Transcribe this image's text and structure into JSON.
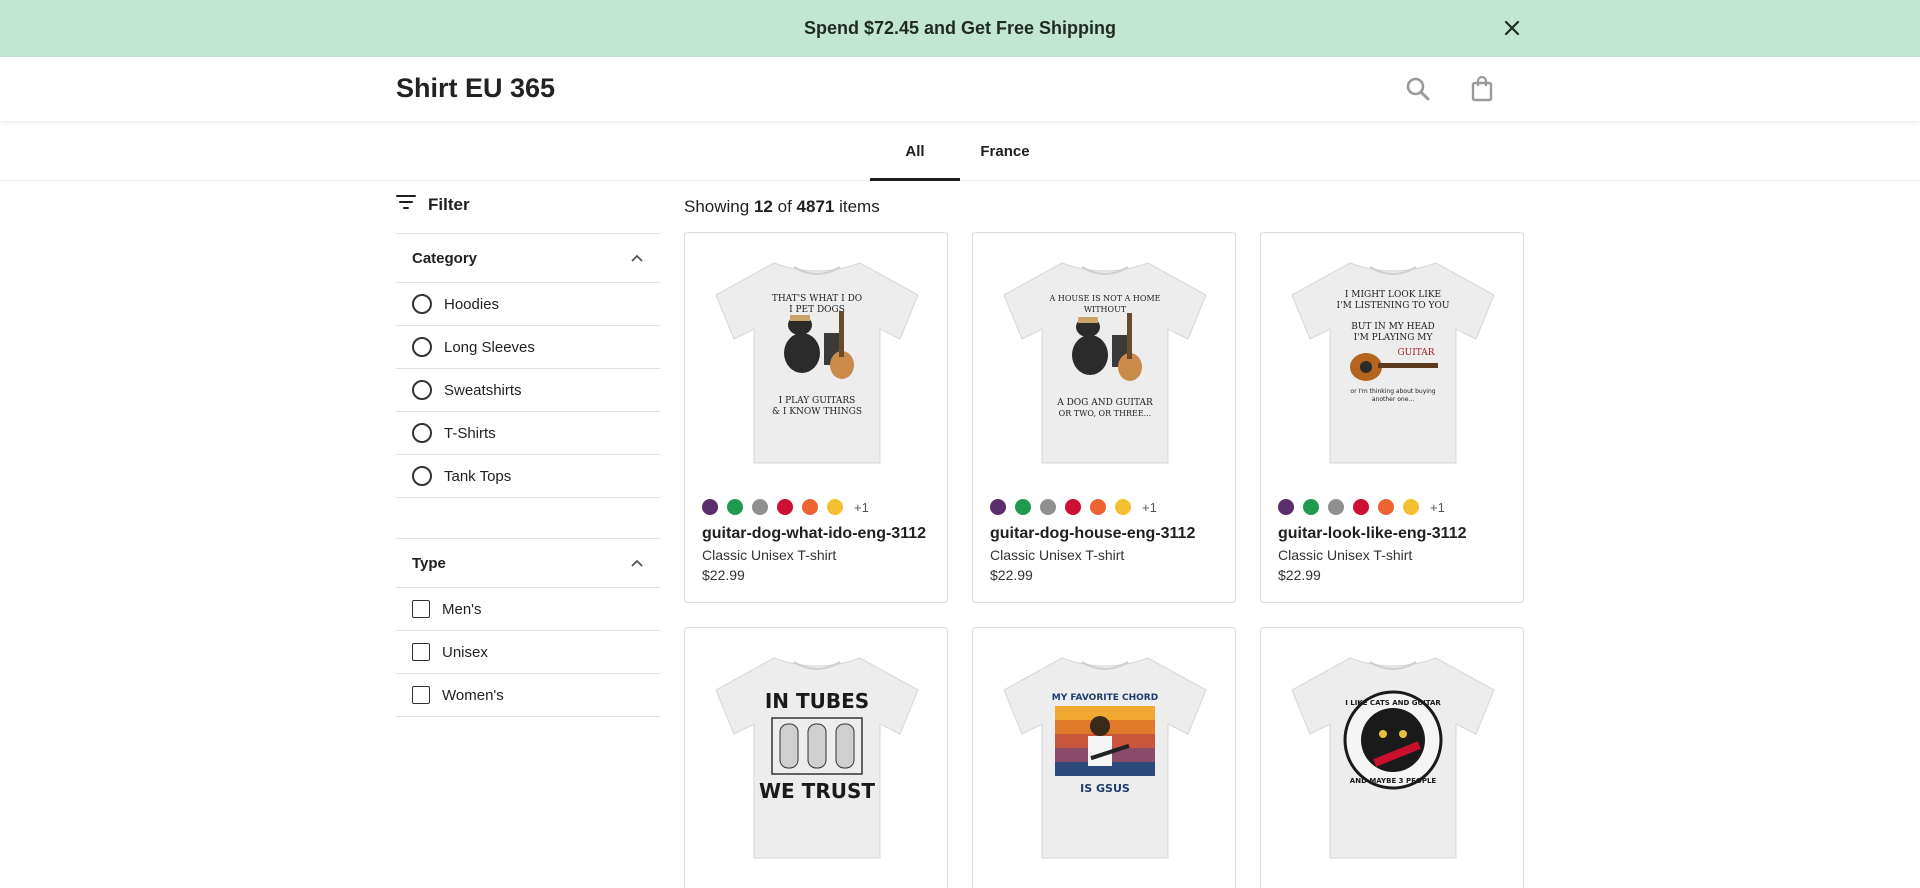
{
  "banner": {
    "text": "Spend $72.45 and Get Free Shipping",
    "close_icon": "close-icon"
  },
  "header": {
    "store_title": "Shirt EU 365",
    "search_icon": "search-icon",
    "bag_icon": "shopping-bag-icon"
  },
  "tabs": [
    {
      "label": "All",
      "active": true
    },
    {
      "label": "France",
      "active": false
    }
  ],
  "filter": {
    "label": "Filter",
    "icon": "filter-icon"
  },
  "category": {
    "title": "Category",
    "options": [
      "Hoodies",
      "Long Sleeves",
      "Sweatshirts",
      "T-Shirts",
      "Tank Tops"
    ]
  },
  "type_filter": {
    "title": "Type",
    "options": [
      "Men's",
      "Unisex",
      "Women's"
    ]
  },
  "results": {
    "prefix": "Showing",
    "shown": "12",
    "of": "of",
    "total": "4871",
    "suffix": "items"
  },
  "swatch_colors": [
    "#5b2d6e",
    "#1f9a4e",
    "#8f8f8f",
    "#cc0f32",
    "#ef6332",
    "#f5bf32"
  ],
  "products": [
    {
      "name": "guitar-dog-what-ido-eng-3112",
      "type": "Classic Unisex T-shirt",
      "price": "$22.99",
      "more_colors": "+1",
      "print_lines": [
        "THAT'S WHAT I DO",
        "I PET DOGS",
        "I PLAY GUITARS",
        "& I KNOW THINGS"
      ]
    },
    {
      "name": "guitar-dog-house-eng-3112",
      "type": "Classic Unisex T-shirt",
      "price": "$22.99",
      "more_colors": "+1",
      "print_lines": [
        "A HOUSE IS NOT A HOME",
        "WITHOUT",
        "A DOG AND GUITAR",
        "OR TWO, OR THREE..."
      ]
    },
    {
      "name": "guitar-look-like-eng-3112",
      "type": "Classic Unisex T-shirt",
      "price": "$22.99",
      "more_colors": "+1",
      "print_lines": [
        "I MIGHT LOOK LIKE",
        "I'M LISTENING TO YOU",
        "BUT IN MY HEAD",
        "I'M PLAYING MY",
        "GUITAR",
        "or I'm thinking about buying",
        "another one..."
      ]
    },
    {
      "print_lines": [
        "IN TUBES",
        "WE TRUST"
      ]
    },
    {
      "print_lines": [
        "MY FAVORITE CHORD",
        "IS GSUS"
      ]
    },
    {
      "print_lines": [
        "I LIKE CATS AND GUITAR",
        "AND MAYBE 3 PEOPLE"
      ]
    }
  ]
}
